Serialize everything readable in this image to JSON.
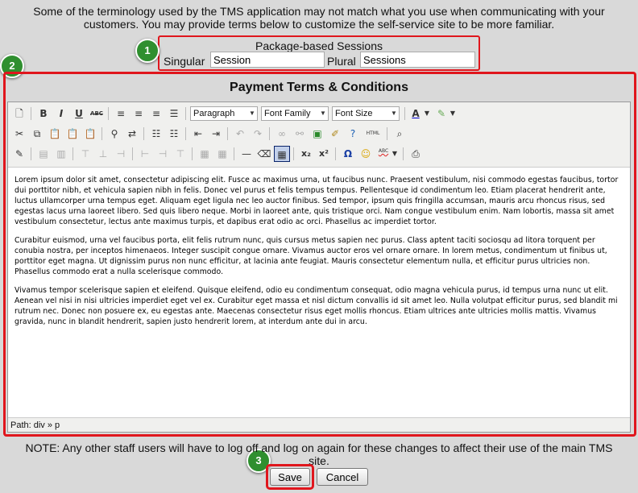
{
  "intro": {
    "line1": "Some of the terminology used by the TMS application may not match what you use when communicating with your",
    "line2": "customers. You may provide terms below to customize the self-service site to be more familiar."
  },
  "package": {
    "title": "Package-based Sessions",
    "singular_label": "Singular",
    "singular_value": "Session",
    "plural_label": "Plural",
    "plural_value": "Sessions"
  },
  "badges": [
    "1",
    "2",
    "3"
  ],
  "section_title": "Payment Terms & Conditions",
  "toolbar": {
    "format_select": "Paragraph",
    "font_family_select": "Font Family",
    "font_size_select": "Font Size",
    "bold": "B",
    "italic": "I",
    "underline": "U",
    "strike": "ABC",
    "html": "HTML",
    "subscript": "x₂",
    "superscript": "x²",
    "omega": "Ω",
    "spell": "ABC"
  },
  "content": {
    "paragraphs": [
      "Lorem ipsum dolor sit amet, consectetur adipiscing elit. Fusce ac maximus urna, ut faucibus nunc. Praesent vestibulum, nisi commodo egestas faucibus, tortor dui porttitor nibh, et vehicula sapien nibh in felis. Donec vel purus et felis tempus tempus. Pellentesque id condimentum leo. Etiam placerat hendrerit ante, luctus ullamcorper urna tempus eget. Aliquam eget ligula nec leo auctor finibus. Sed tempor, ipsum quis fringilla accumsan, mauris arcu rhoncus risus, sed egestas lacus urna laoreet libero. Sed quis libero neque. Morbi in laoreet ante, quis tristique orci. Nam congue vestibulum enim. Nam lobortis, massa sit amet vestibulum consectetur, lectus ante maximus turpis, et dapibus erat odio ac orci. Phasellus ac imperdiet tortor.",
      "Curabitur euismod, urna vel faucibus porta, elit felis rutrum nunc, quis cursus metus sapien nec purus. Class aptent taciti sociosqu ad litora torquent per conubia nostra, per inceptos himenaeos. Integer suscipit congue ornare. Vivamus auctor eros vel ornare ornare. In lorem metus, condimentum ut finibus ut, porttitor eget magna. Ut dignissim purus non nunc efficitur, at lacinia ante feugiat. Mauris consectetur elementum nulla, et efficitur purus ultricies non. Phasellus commodo erat a nulla scelerisque commodo.",
      "Vivamus tempor scelerisque sapien et eleifend. Quisque eleifend, odio eu condimentum consequat, odio magna vehicula purus, id tempus urna nunc ut elit. Aenean vel nisi in nisi ultricies imperdiet eget vel ex. Curabitur eget massa et nisl dictum convallis id sit amet leo. Nulla volutpat efficitur purus, sed blandit mi rutrum nec. Donec non posuere ex, eu egestas ante. Maecenas consectetur risus eget mollis rhoncus. Etiam ultrices ante ultricies mollis mattis. Vivamus gravida, nunc in blandit hendrerit, sapien justo hendrerit lorem, at interdum ante dui in arcu."
    ]
  },
  "path_bar": "Path: div » p",
  "note": {
    "line1": "NOTE: Any other staff users will have to log off and log on again for these changes to affect their use of the main TMS",
    "line2": "site."
  },
  "buttons": {
    "save": "Save",
    "cancel": "Cancel"
  },
  "colors": {
    "highlight_red": "#e0161d",
    "badge_green": "#2f8f2f",
    "page_bg": "#d9d9d9"
  }
}
